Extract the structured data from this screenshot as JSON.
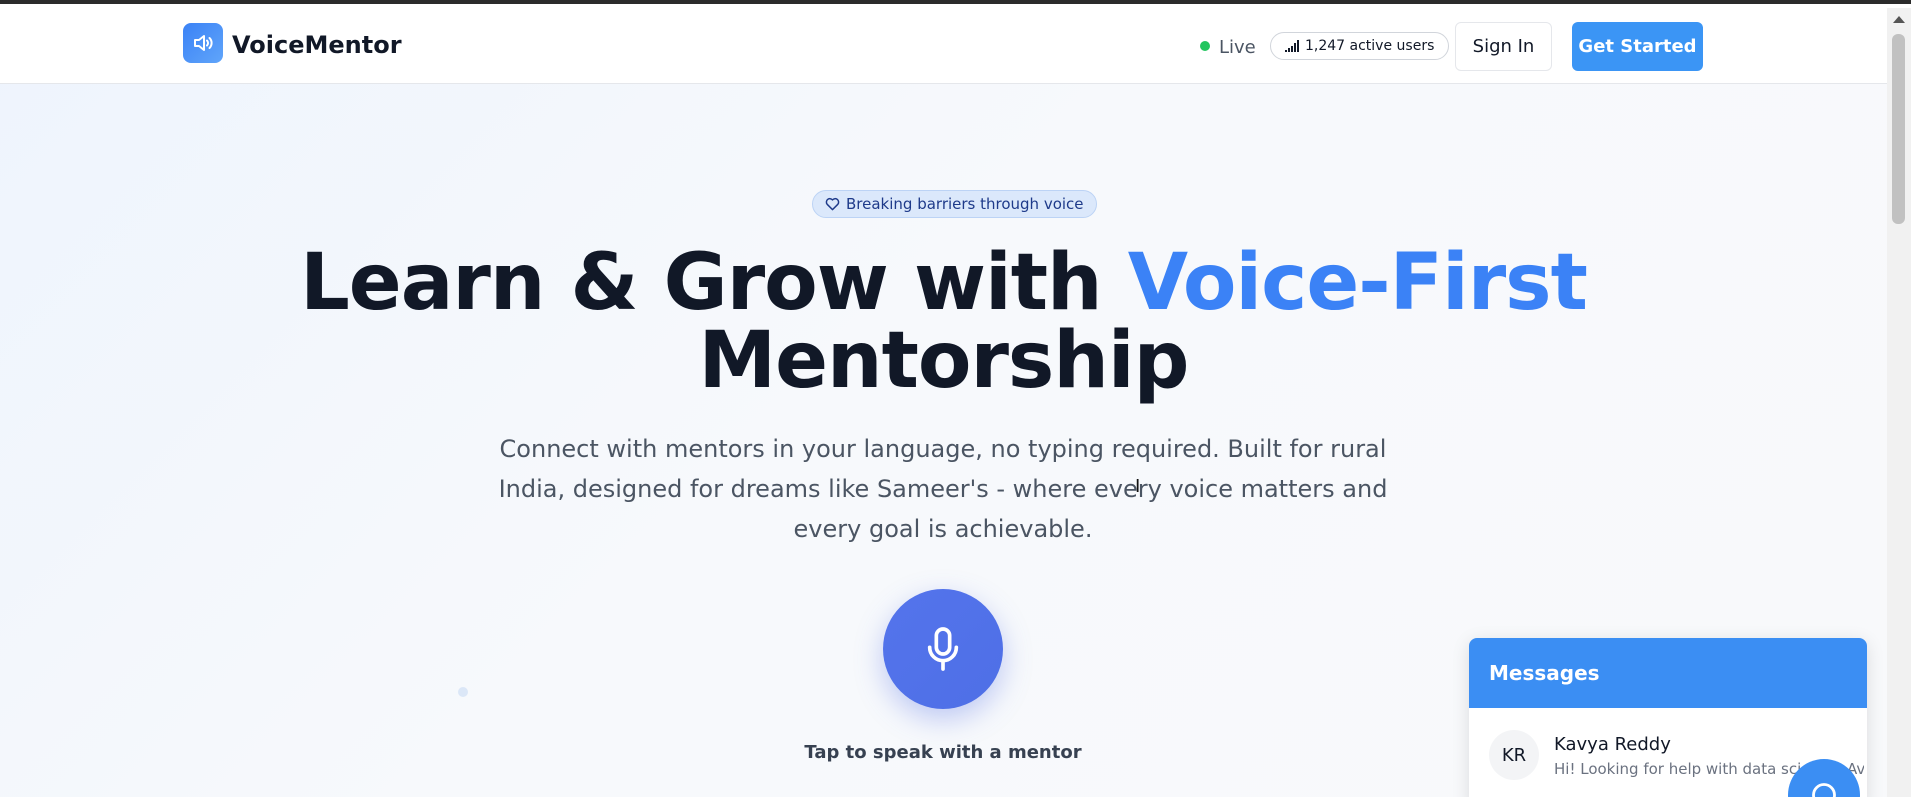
{
  "header": {
    "brand": "VoiceMentor",
    "live_label": "Live",
    "active_users": "1,247 active users",
    "signin_label": "Sign In",
    "get_started_label": "Get Started"
  },
  "hero": {
    "badge": "Breaking barriers through voice",
    "headline_part1": "Learn & Grow with ",
    "headline_accent": "Voice-First",
    "headline_part2": "Mentorship",
    "subtitle": "Connect with mentors in your language, no typing required. Built for rural India, designed for dreams like Sameer's - where every voice matters and every goal is achievable.",
    "mic_caption": "Tap to speak with a mentor"
  },
  "messages": {
    "title": "Messages",
    "items": [
      {
        "initials": "KR",
        "name": "Kavya Reddy",
        "preview": "Hi! Looking for help with data science. Available"
      }
    ]
  },
  "colors": {
    "accent": "#3b82f6",
    "button_primary": "#3b95f5",
    "mic": "#5474ec",
    "live": "#22c55e",
    "messages_header": "#3b8ef3"
  },
  "icons": {
    "logo": "speaker-icon",
    "users": "signal-bars-icon",
    "badge": "heart-icon",
    "mic": "microphone-icon",
    "fab": "chat-icon"
  }
}
